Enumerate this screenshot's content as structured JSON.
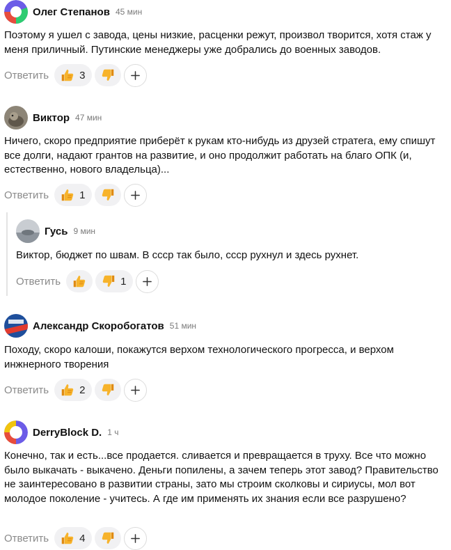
{
  "labels": {
    "reply": "Ответить"
  },
  "icons": {
    "like": "thumbs-up-icon",
    "dislike": "thumbs-down-icon",
    "add": "plus-icon"
  },
  "colors": {
    "like": "#f5a623",
    "dislike": "#f5a623",
    "reply_text": "#8a8a8a",
    "pill_bg": "#f1f1f3"
  },
  "comments": [
    {
      "author": "Олег Степанов",
      "time": "45 мин",
      "text": "Поэтому я ушел с завода, цены низкие, расценки режут, произвол творится, хотя стаж у меня приличный. Путинские менеджеры уже добрались до военных заводов.",
      "likes": "3",
      "dislikes": ""
    },
    {
      "author": "Виктор",
      "time": "47 мин",
      "text": "Ничего, скоро предприятие приберёт к рукам кто-нибудь из друзей стратега, ему спишут все долги, надают грантов на развитие, и оно продолжит работать на благо ОПК (и, естественно, нового владельца)...",
      "likes": "1",
      "dislikes": ""
    },
    {
      "author": "Гусь",
      "time": "9 мин",
      "text": "Виктор, бюджет по швам. В ссср так было, ссср рухнул и здесь рухнет.",
      "likes": "",
      "dislikes": "1"
    },
    {
      "author": "Александр Скоробогатов",
      "time": "51 мин",
      "text": "Походу, скоро калоши, покажутся верхом технологического прогресса, и верхом инжнерного творения",
      "likes": "2",
      "dislikes": ""
    },
    {
      "author": "DerryBlock D.",
      "time": "1 ч",
      "text": "Конечно, так и есть...все продается. сливается и превращается в труху. Все что можно было выкачать - выкачено. Деньги попилены, а зачем теперь этот завод? Правительство не заинтересовано в развитии страны, зато мы строим сколковы и сириусы, мол вот молодое поколение - учитесь. А где им применять их знания если все разрушено?",
      "likes": "4",
      "dislikes": ""
    }
  ]
}
